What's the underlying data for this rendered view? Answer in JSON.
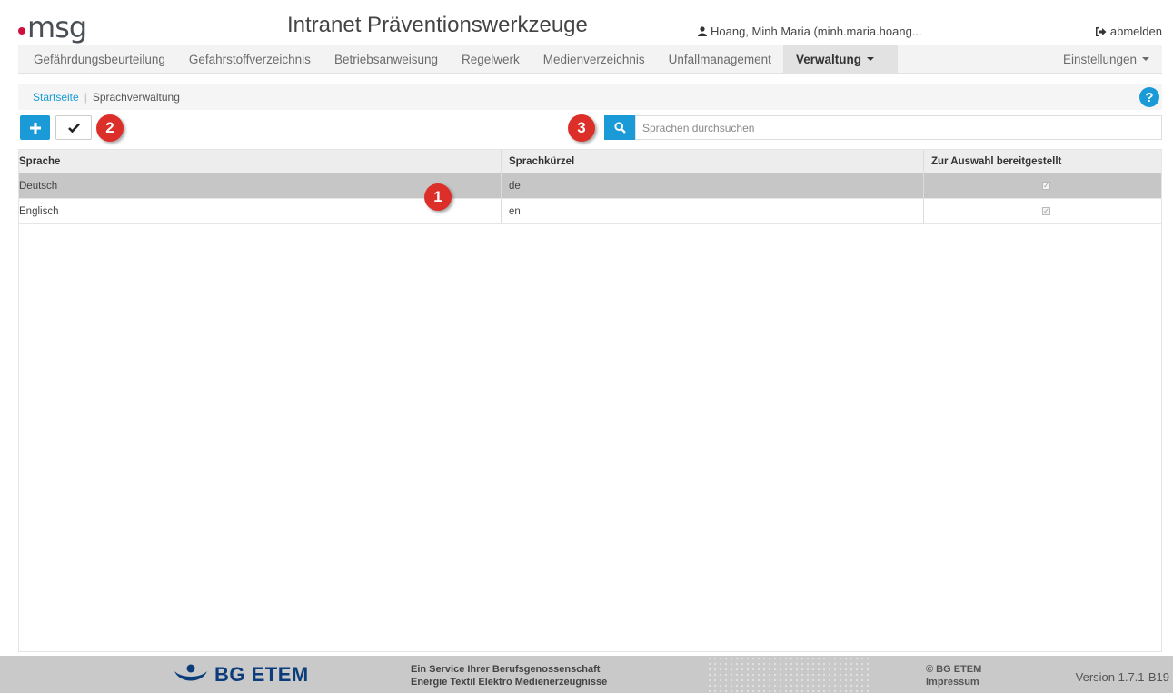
{
  "header": {
    "logo_text": "msg",
    "app_title": "Intranet Präventionswerkzeuge",
    "user_name": "Hoang, Minh Maria (minh.maria.hoang...",
    "logout_label": "abmelden"
  },
  "nav": {
    "items": [
      {
        "label": "Gefährdungsbeurteilung"
      },
      {
        "label": "Gefahrstoffverzeichnis"
      },
      {
        "label": "Betriebsanweisung"
      },
      {
        "label": "Regelwerk"
      },
      {
        "label": "Medienverzeichnis"
      },
      {
        "label": "Unfallmanagement"
      },
      {
        "label": "Verwaltung"
      }
    ],
    "settings_label": "Einstellungen"
  },
  "breadcrumb": {
    "home": "Startseite",
    "separator": "|",
    "current": "Sprachverwaltung",
    "help_icon": "?"
  },
  "toolbar": {
    "add_icon": "plus-icon",
    "check_icon": "check-icon",
    "search_placeholder": "Sprachen durchsuchen"
  },
  "badges": [
    "1",
    "2",
    "3"
  ],
  "table": {
    "headers": [
      "Sprache",
      "Sprachkürzel",
      "Zur Auswahl bereitgestellt"
    ],
    "rows": [
      {
        "sprache": "Deutsch",
        "kuerzel": "de",
        "bereitgestellt": true,
        "selected": true
      },
      {
        "sprache": "Englisch",
        "kuerzel": "en",
        "bereitgestellt": true,
        "selected": false
      }
    ]
  },
  "footer": {
    "brand": "BG ETEM",
    "service_line1": "Ein Service Ihrer Berufsgenossenschaft",
    "service_line2": "Energie Textil Elektro Medienerzeugnisse",
    "copyright": "© BG ETEM",
    "impressum": "Impressum",
    "version": "Version 1.7.1-B19"
  },
  "colors": {
    "accent": "#1a9bd7",
    "badge": "#dd2f2a",
    "brand_blue": "#0b3d7a",
    "logo_dot": "#d0103a"
  }
}
